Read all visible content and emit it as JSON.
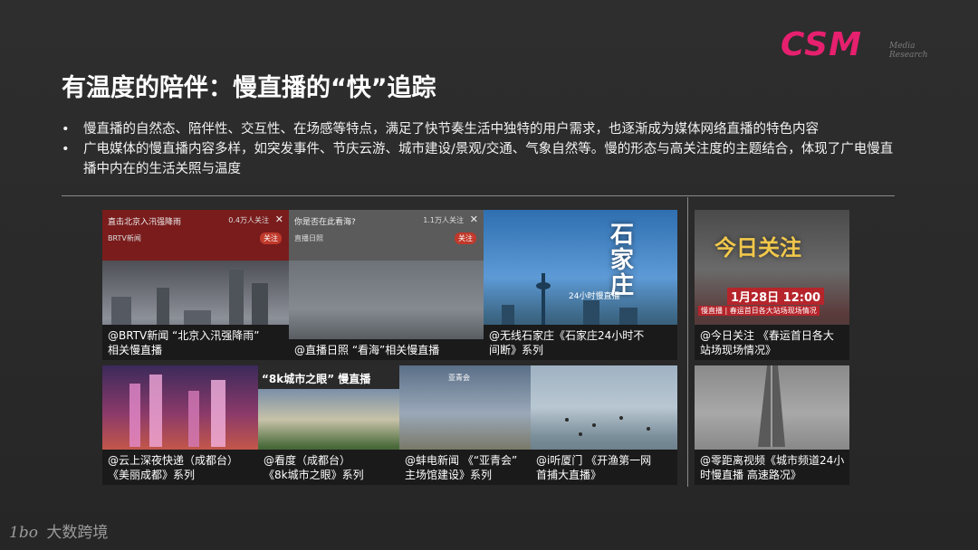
{
  "logo": {
    "text": "CSM",
    "sub_line1": "Media",
    "sub_line2": "Research"
  },
  "title": "有温度的陪伴：慢直播的“快”追踪",
  "bullets": [
    {
      "dot": "•",
      "text": "慢直播的自然态、陪伴性、交互性、在场感等特点，满足了快节奏生活中独特的用户需求，也逐渐成为媒体网络直播的特色内容"
    },
    {
      "dot": "•",
      "text": "广电媒体的慢直播内容多样，如突发事件、节庆云游、城市建设/景观/交通、气象自然等。慢的形态与高关注度的主题结合，体现了广电慢直播中内在的生活关照与温度"
    }
  ],
  "cards": [
    {
      "app_title": "直击北京入汛强降雨",
      "app_stat": "0.4万人关注",
      "app_channel": "BRTV新闻",
      "app_pill": "关注",
      "caption1": "@BRTV新闻 “北京入汛强降雨”",
      "caption2": "相关慢直播"
    },
    {
      "app_title": "你是否在此看海?",
      "app_stat": "1.1万人关注",
      "app_channel": "直播日照",
      "app_pill": "关注",
      "caption1": "@直播日照 “看海”相关慢直播",
      "caption2": ""
    },
    {
      "overlay": "石家庄",
      "overlay_sub": "24小时慢直播",
      "caption1": "@无线石家庄《石家庄24小时不",
      "caption2": "间断》系列"
    },
    {
      "overlay": "今日关注",
      "overlay_time": "1月28日 12:00",
      "overlay_sub": "慢直播 | 春运首日各大站场现场情况",
      "caption1": "@今日关注 《春运首日各大",
      "caption2": "站场现场情况》"
    },
    {
      "caption1": "@云上深夜快递（成都台）",
      "caption2": "《美丽成都》系列"
    },
    {
      "overlay": "“8k城市之眼” 慢直播",
      "caption1": "@看度（成都台）",
      "caption2": "《8k城市之眼》系列"
    },
    {
      "overlay": "亚青会",
      "caption1": "@蚌电新闻 《“亚青会”",
      "caption2": "主场馆建设》系列"
    },
    {
      "caption1": "@i听厦门 《开渔第一网",
      "caption2": "首捕大直播》"
    },
    {
      "caption1": "@零距离视频《城市频道24小",
      "caption2": "时慢直播 高速路况》"
    }
  ],
  "footer": {
    "mark": "1bo",
    "brand": "大数跨境"
  },
  "colors": {
    "background": "#2b2b2b",
    "accent": "#e6206e",
    "text": "#ffffff"
  }
}
